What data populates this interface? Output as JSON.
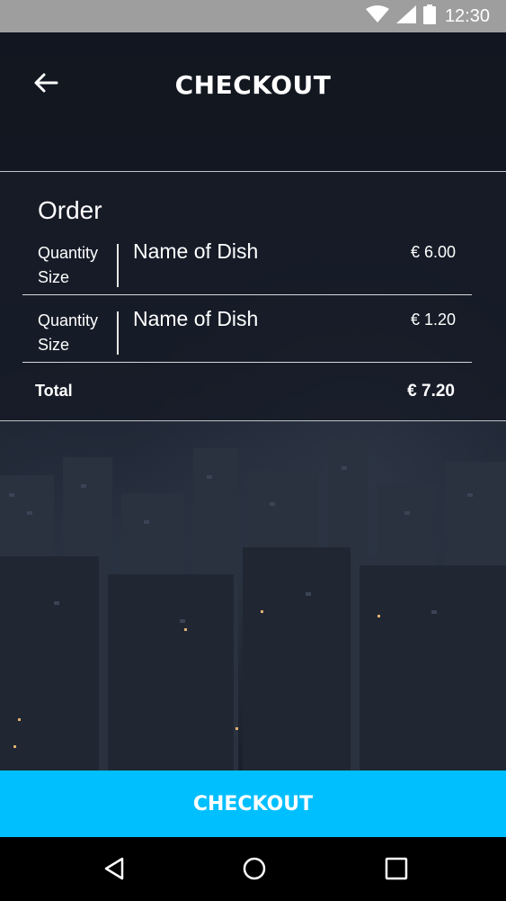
{
  "status_bar": {
    "time": "12:30",
    "icons": [
      "wifi-icon",
      "signal-icon",
      "battery-icon"
    ],
    "background": "#9e9e9e"
  },
  "header": {
    "title": "CHECKOUT",
    "back_icon": "arrow-left-icon"
  },
  "order": {
    "heading": "Order",
    "items": [
      {
        "quantity_label": "Quantity",
        "size_label": "Size",
        "name": "Name of Dish",
        "price": "€ 6.00"
      },
      {
        "quantity_label": "Quantity",
        "size_label": "Size",
        "name": "Name of Dish",
        "price": "€ 1.20"
      }
    ],
    "total_label": "Total",
    "total_value": "€ 7.20"
  },
  "checkout_button": {
    "label": "CHECKOUT",
    "color": "#00bfff"
  },
  "nav_bar": {
    "icons": [
      "back-triangle-icon",
      "home-circle-icon",
      "recents-square-icon"
    ]
  }
}
